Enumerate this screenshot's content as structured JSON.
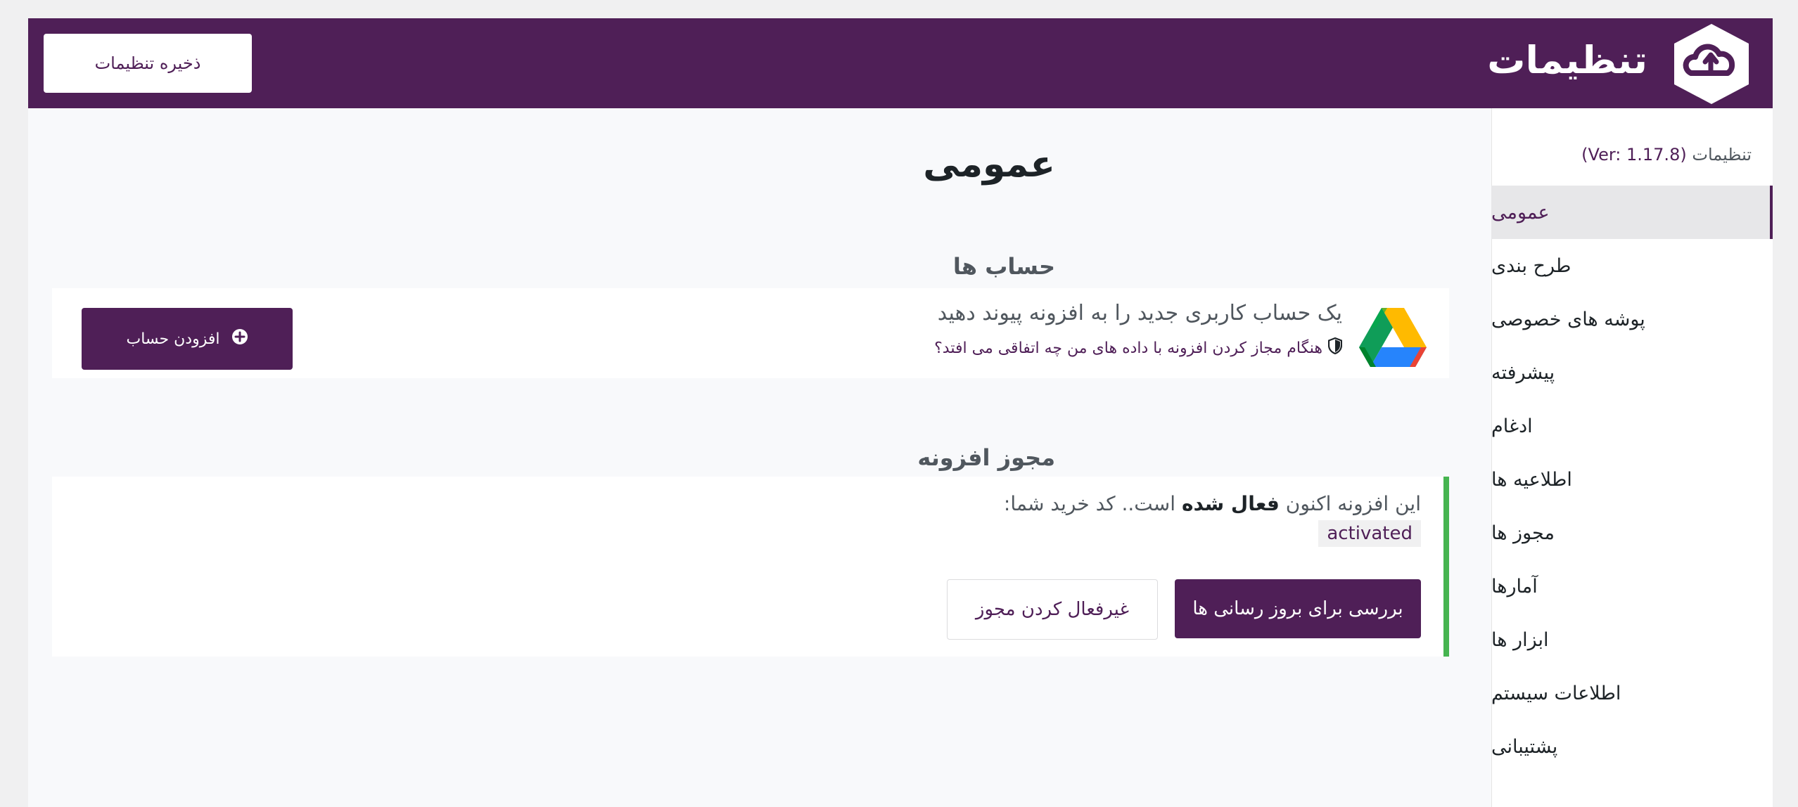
{
  "header": {
    "title": "تنظیمات",
    "save_label": "ذخیره تنظیمات",
    "logo_icon": "cloud-sync-logo-icon"
  },
  "sidebar": {
    "version_label": "تنظیمات",
    "version": "(Ver: 1.17.8)",
    "items": [
      {
        "label": "عمومی",
        "active": true
      },
      {
        "label": "طرح بندی"
      },
      {
        "label": "پوشه های خصوصی"
      },
      {
        "label": "پیشرفته"
      },
      {
        "label": "ادغام"
      },
      {
        "label": "اطلاعیه ها"
      },
      {
        "label": "مجوز ها"
      },
      {
        "label": "آمارها"
      },
      {
        "label": "ابزار ها"
      },
      {
        "label": "اطلاعات سیستم"
      },
      {
        "label": "پشتیبانی"
      }
    ]
  },
  "main": {
    "page_title": "عمومی",
    "accounts": {
      "title": "حساب ها",
      "link_text": "یک حساب کاربری جدید را به افزونه پیوند دهید",
      "privacy_note": "هنگام مجاز کردن افزونه با داده های من چه اتفاقی می افتد؟",
      "add_button": "افزودن حساب",
      "service_icon": "google-drive-icon"
    },
    "license": {
      "title": "مجوز افزونه",
      "text_before": "این افزونه اکنون ",
      "text_bold": "فعال شده",
      "text_after": " است.. کد خرید شما:",
      "code": "activated",
      "check_updates_button": "بررسی برای بروز رسانی ها",
      "deactivate_button": "غیرفعال کردن مجوز"
    }
  },
  "colors": {
    "brand": "#4f1f57",
    "success": "#46b450"
  }
}
